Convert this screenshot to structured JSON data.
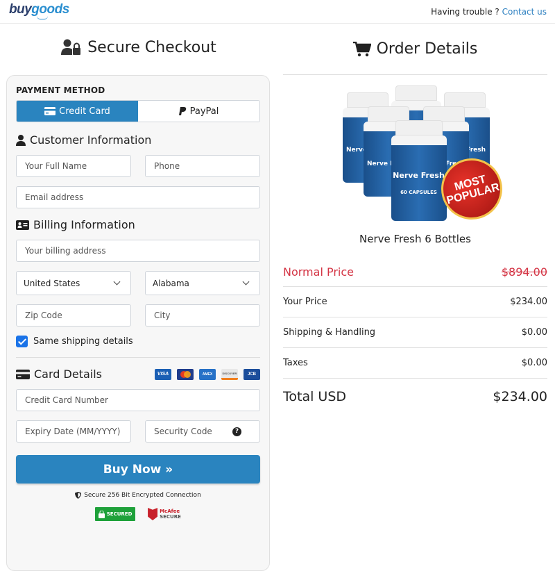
{
  "header": {
    "logo_part1": "buy",
    "logo_part2": "goods",
    "help_text": "Having trouble ?",
    "contact_link": "Contact us"
  },
  "checkout": {
    "title": "Secure Checkout",
    "payment_method_label": "PAYMENT METHOD",
    "tabs": [
      {
        "label": "Credit Card",
        "icon": "credit-card-icon",
        "active": true
      },
      {
        "label": "PayPal",
        "icon": "paypal-icon",
        "active": false
      }
    ],
    "customer_info_title": "Customer Information",
    "full_name_placeholder": "Your Full Name",
    "phone_placeholder": "Phone",
    "email_placeholder": "Email address",
    "billing_info_title": "Billing Information",
    "billing_address_placeholder": "Your billing address",
    "country_selected": "United States",
    "state_selected": "Alabama",
    "zip_placeholder": "Zip Code",
    "city_placeholder": "City",
    "same_shipping_label": "Same shipping details",
    "same_shipping_checked": true,
    "card_details_title": "Card Details",
    "card_brands": [
      "VISA",
      "MasterCard",
      "AMEX",
      "DISCOVER",
      "JCB"
    ],
    "card_number_placeholder": "Credit Card Number",
    "expiry_placeholder": "Expiry Date (MM/YYYY)",
    "security_code_placeholder": "Security Code",
    "buy_button": "Buy Now »",
    "secure_text": "Secure 256 Bit Encrypted Connection",
    "trust_badges": [
      "SECURED",
      "McAfee SECURE"
    ]
  },
  "order": {
    "title": "Order Details",
    "product_name": "Nerve Fresh 6 Bottles",
    "bottle_label": "Nerve Fresh",
    "bottle_sub": "60 CAPSULES",
    "badge_line1": "MOST",
    "badge_line2": "POPULAR",
    "rows": [
      {
        "label": "Normal Price",
        "value": "$894.00"
      },
      {
        "label": "Your Price",
        "value": "$234.00"
      },
      {
        "label": "Shipping & Handling",
        "value": "$0.00"
      },
      {
        "label": "Taxes",
        "value": "$0.00"
      }
    ],
    "total_label": "Total USD",
    "total_value": "$234.00"
  },
  "colors": {
    "brand_blue": "#2a84bf",
    "price_red": "#d43545"
  }
}
